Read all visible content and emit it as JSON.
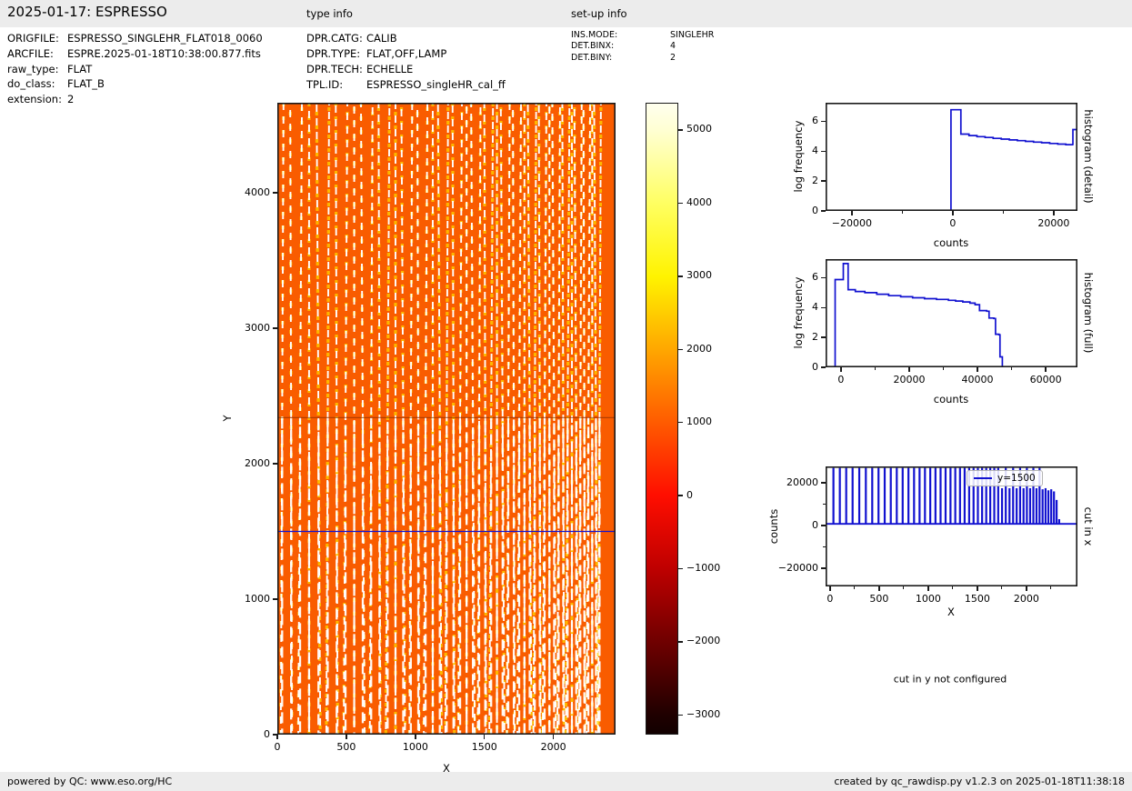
{
  "header": {
    "title": "2025-01-17: ESPRESSO",
    "type_info": "type info",
    "setup_info": "set-up info"
  },
  "metadata": {
    "left": [
      {
        "label": "ORIGFILE:",
        "value": "ESPRESSO_SINGLEHR_FLAT018_0060"
      },
      {
        "label": "ARCFILE:",
        "value": "ESPRE.2025-01-18T10:38:00.877.fits"
      },
      {
        "label": "raw_type:",
        "value": "FLAT"
      },
      {
        "label": "do_class:",
        "value": "FLAT_B"
      },
      {
        "label": "extension:",
        "value": "2"
      }
    ],
    "middle": [
      {
        "label": "DPR.CATG:",
        "value": "CALIB"
      },
      {
        "label": "DPR.TYPE:",
        "value": "FLAT,OFF,LAMP"
      },
      {
        "label": "DPR.TECH:",
        "value": "ECHELLE"
      },
      {
        "label": "TPL.ID:",
        "value": "ESPRESSO_singleHR_cal_ff"
      }
    ],
    "right": [
      {
        "label": "INS.MODE:",
        "value": "SINGLEHR"
      },
      {
        "label": "DET.BINX:",
        "value": "4"
      },
      {
        "label": "DET.BINY:",
        "value": "2"
      }
    ]
  },
  "note": "cut in y not configured",
  "footer": {
    "left": "powered by QC: www.eso.org/HC",
    "right": "created by qc_rawdisp.py v1.2.3 on 2025-01-18T11:38:18"
  },
  "colors": {
    "accent_blue": "#1212d0",
    "image_orange": "#f95c00",
    "stripe_white": "#ffffff",
    "stripe_yellow": "#ffd400",
    "seam_dark": "rgba(140,45,0,0.65)",
    "header_gray": "#ececec",
    "spine": "#1a1a1a"
  },
  "chart_data": [
    {
      "type": "heatmap",
      "name": "raw frame display",
      "xlabel": "X",
      "ylabel": "Y",
      "xlim": [
        0,
        2450
      ],
      "ylim": [
        0,
        4665
      ],
      "xticks": [
        0,
        500,
        1000,
        1500,
        2000
      ],
      "yticks": [
        0,
        1000,
        2000,
        3000,
        4000
      ],
      "colormap": "hot",
      "cut_line_y": 1500,
      "detector_seam_y": 2340,
      "description": "orange echelle flat-field raw frame with dashed vertical order stripes; blue cut line at y=1500"
    },
    {
      "type": "colorbar",
      "vmin": -3270,
      "vmax": 5373,
      "ticks": [
        5000,
        4000,
        3000,
        2000,
        1000,
        0,
        -1000,
        -2000,
        -3000
      ],
      "gradient": [
        {
          "v": 5373,
          "c": "#ffffee"
        },
        {
          "v": 5000,
          "c": "#ffffd2"
        },
        {
          "v": 4000,
          "c": "#ffff61"
        },
        {
          "v": 3000,
          "c": "#fff300"
        },
        {
          "v": 2000,
          "c": "#ffa700"
        },
        {
          "v": 1000,
          "c": "#ff5b00"
        },
        {
          "v": 0,
          "c": "#ff0e00"
        },
        {
          "v": -1000,
          "c": "#bf0000"
        },
        {
          "v": -2000,
          "c": "#700000"
        },
        {
          "v": -3000,
          "c": "#200000"
        },
        {
          "v": -3270,
          "c": "#120000"
        }
      ]
    },
    {
      "type": "line",
      "name": "histogram (detail)",
      "xlabel": "counts",
      "ylabel": "log frequency",
      "xlim": [
        -25200,
        24700
      ],
      "ylim": [
        0,
        7.25
      ],
      "xticks": [
        -20000,
        0,
        20000
      ],
      "xminor": [
        -10000,
        10000
      ],
      "yticks": [
        0,
        2,
        4,
        6
      ],
      "points": [
        [
          -25200,
          0.03
        ],
        [
          -350,
          0.03
        ],
        [
          -350,
          6.78
        ],
        [
          1600,
          6.78
        ],
        [
          1600,
          5.15
        ],
        [
          3200,
          5.05
        ],
        [
          4800,
          4.98
        ],
        [
          6400,
          4.92
        ],
        [
          8000,
          4.86
        ],
        [
          9600,
          4.81
        ],
        [
          11200,
          4.76
        ],
        [
          12800,
          4.71
        ],
        [
          14400,
          4.66
        ],
        [
          16000,
          4.61
        ],
        [
          17600,
          4.57
        ],
        [
          19200,
          4.52
        ],
        [
          20800,
          4.48
        ],
        [
          22400,
          4.44
        ],
        [
          23800,
          4.4
        ],
        [
          23800,
          5.45
        ],
        [
          24700,
          5.45
        ]
      ]
    },
    {
      "type": "line",
      "name": "histogram (full)",
      "xlabel": "counts",
      "ylabel": "log frequency",
      "xlim": [
        -4500,
        69300
      ],
      "ylim": [
        0,
        7.25
      ],
      "xticks": [
        0,
        20000,
        40000,
        60000
      ],
      "xminor": [
        10000,
        30000,
        50000
      ],
      "yticks": [
        0,
        2,
        4,
        6
      ],
      "points": [
        [
          -4500,
          0.03
        ],
        [
          -1700,
          0.03
        ],
        [
          -1700,
          5.88
        ],
        [
          700,
          5.88
        ],
        [
          700,
          6.95
        ],
        [
          2100,
          6.95
        ],
        [
          2100,
          5.2
        ],
        [
          4200,
          5.08
        ],
        [
          7000,
          5.0
        ],
        [
          10500,
          4.9
        ],
        [
          14000,
          4.8
        ],
        [
          17500,
          4.73
        ],
        [
          21000,
          4.66
        ],
        [
          24500,
          4.6
        ],
        [
          28000,
          4.55
        ],
        [
          31500,
          4.49
        ],
        [
          33600,
          4.44
        ],
        [
          35700,
          4.38
        ],
        [
          37800,
          4.3
        ],
        [
          39300,
          4.2
        ],
        [
          40600,
          3.8
        ],
        [
          42700,
          3.76
        ],
        [
          43400,
          3.3
        ],
        [
          44800,
          3.27
        ],
        [
          45300,
          2.22
        ],
        [
          46300,
          2.18
        ],
        [
          46600,
          0.7
        ],
        [
          47300,
          0.67
        ],
        [
          47300,
          0.03
        ],
        [
          69300,
          0.03
        ]
      ]
    },
    {
      "type": "spikes",
      "name": "cut in x",
      "xlabel": "X",
      "ylabel": "counts",
      "legend_label": "y=1500",
      "xlim": [
        -45,
        2520
      ],
      "ylim": [
        -28500,
        27700
      ],
      "xticks": [
        0,
        500,
        1000,
        1500,
        2000
      ],
      "xminor": [
        250,
        750,
        1250,
        1750,
        2250
      ],
      "yticks": [
        -20000,
        0,
        20000
      ],
      "yminor": [
        -10000,
        10000
      ],
      "baseline": 800,
      "spikes": [
        [
          35,
          27000
        ],
        [
          100,
          27000
        ],
        [
          165,
          27000
        ],
        [
          230,
          27000
        ],
        [
          298,
          27000
        ],
        [
          365,
          27000
        ],
        [
          430,
          27000
        ],
        [
          494,
          27000
        ],
        [
          557,
          27000
        ],
        [
          619,
          27000
        ],
        [
          680,
          27000
        ],
        [
          740,
          27000
        ],
        [
          799,
          27000
        ],
        [
          856,
          27000
        ],
        [
          912,
          27000
        ],
        [
          967,
          27000
        ],
        [
          1021,
          27000
        ],
        [
          1074,
          27000
        ],
        [
          1126,
          27000
        ],
        [
          1177,
          27000
        ],
        [
          1227,
          27000
        ],
        [
          1276,
          27000
        ],
        [
          1324,
          27000
        ],
        [
          1371,
          27000
        ],
        [
          1417,
          27000
        ],
        [
          1462,
          27000
        ],
        [
          1506,
          27000
        ],
        [
          1549,
          27000
        ],
        [
          1591,
          27000
        ],
        [
          1632,
          27000
        ],
        [
          1673,
          27000
        ],
        [
          1713,
          27000
        ],
        [
          1752,
          17500
        ],
        [
          1790,
          27000
        ],
        [
          1828,
          17500
        ],
        [
          1865,
          27000
        ],
        [
          1901,
          17500
        ],
        [
          1936,
          27000
        ],
        [
          1971,
          17500
        ],
        [
          2005,
          27000
        ],
        [
          2038,
          17500
        ],
        [
          2071,
          27000
        ],
        [
          2103,
          17500
        ],
        [
          2134,
          27000
        ],
        [
          2165,
          17000
        ],
        [
          2195,
          17500
        ],
        [
          2224,
          16500
        ],
        [
          2253,
          17000
        ],
        [
          2281,
          16000
        ],
        [
          2308,
          12000
        ],
        [
          2334,
          3000
        ]
      ]
    }
  ]
}
